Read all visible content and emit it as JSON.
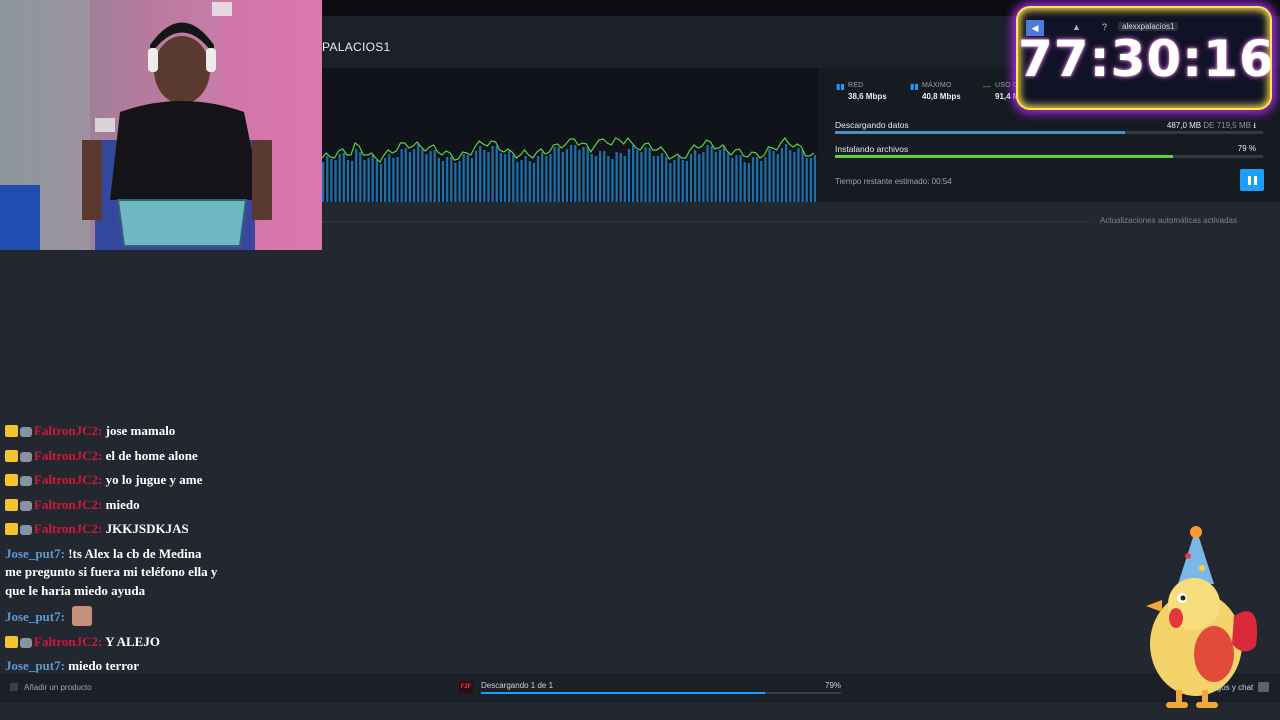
{
  "library": {
    "page_title": "PALACIOS1",
    "auto_updates": "Actualizaciones automáticas activadas"
  },
  "download_panel": {
    "stats": [
      {
        "label": "RED",
        "value": "38,6 Mbps",
        "color": "#1a9fff"
      },
      {
        "label": "MÁXIMO",
        "value": "40,8 Mbps",
        "color": "#1a9fff"
      },
      {
        "label": "USO DEL DISCO",
        "value": "91,4 MB/s",
        "color": "#5ad146"
      }
    ],
    "downloading_label": "Descargando datos",
    "downloaded_amount": "487,0 MB",
    "downloaded_of": "DE 719,5 MB",
    "download_fraction": 0.677,
    "installing_label": "Instalando archivos",
    "install_percent": "79 %",
    "install_fraction": 0.79,
    "eta": "Tiempo restante estimado: 00:54"
  },
  "timer_overlay": {
    "username": "alexxpalacios1",
    "time": "77:30:16"
  },
  "chat": [
    {
      "nick": "FaltronJC2:",
      "color": "red",
      "badges": true,
      "text": "jose mamalo"
    },
    {
      "nick": "FaltronJC2:",
      "color": "red",
      "badges": true,
      "text": "el de home alone"
    },
    {
      "nick": "FaltronJC2:",
      "color": "red",
      "badges": true,
      "text": "yo lo jugue y ame"
    },
    {
      "nick": "FaltronJC2:",
      "color": "red",
      "badges": true,
      "text": "miedo"
    },
    {
      "nick": "FaltronJC2:",
      "color": "red",
      "badges": true,
      "text": "JKKJSDKJAS"
    },
    {
      "nick": "Jose_put7:",
      "color": "blue",
      "badges": false,
      "text": "!ts Alex la cb de Medina me pregunto si fuera mi teléfono ella y que le haría miedo ayuda"
    },
    {
      "nick": "Jose_put7:",
      "color": "blue",
      "badges": false,
      "text": "",
      "emote": true
    },
    {
      "nick": "FaltronJC2:",
      "color": "red",
      "badges": true,
      "text": "Y ALEJO"
    },
    {
      "nick": "Jose_put7:",
      "color": "blue",
      "badges": false,
      "text": "miedo terror"
    }
  ],
  "bottom_bar": {
    "add_product": "Añadir un producto",
    "game_icon": "F2F",
    "downloading": "Descargando 1 de 1",
    "percent": "79%",
    "progress_fraction": 0.79,
    "friends": "Amigos y chat"
  },
  "icons": {
    "pause": "pause-icon",
    "download": "download-icon",
    "announce": "megaphone-icon",
    "bell": "bell-icon",
    "help": "help-icon"
  },
  "colors": {
    "accent": "#1a9fff",
    "install_green": "#5ad146",
    "chat_red": "#d0183a",
    "chat_blue": "#5b9bd5"
  }
}
